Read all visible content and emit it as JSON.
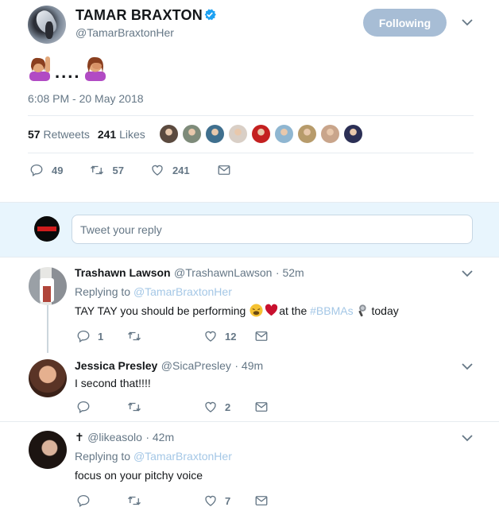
{
  "tweet": {
    "display_name": "TAMAR BRAXTON",
    "handle": "@TamarBraxtonHer",
    "follow_label": "Following",
    "text_dots": "....",
    "timestamp": "6:08 PM - 20 May 2018",
    "stats": {
      "retweets_count": "57",
      "retweets_label": "Retweets",
      "likes_count": "241",
      "likes_label": "Likes"
    },
    "liker_colors": [
      "#5b4a3f",
      "#7e8b7a",
      "#3f6f8e",
      "#d9cfc6",
      "#c42020",
      "#8fb6d1",
      "#b79b6b",
      "#c9a58b",
      "#2b2f55"
    ],
    "actions": {
      "replies": "49",
      "retweets": "57",
      "likes": "241"
    }
  },
  "composer": {
    "placeholder": "Tweet your reply"
  },
  "replies": [
    {
      "name": "Trashawn Lawson",
      "handle": "@TrashawnLawson",
      "time": "· 52m",
      "replying_prefix": "Replying to",
      "replying_to": "@TamarBraxtonHer",
      "text_a": "TAY TAY you should be performing",
      "text_b": "at the",
      "hashtag": "#BBMAs",
      "text_c": "today",
      "replies": "1",
      "retweets": "",
      "likes": "12"
    },
    {
      "name": "Jessica Presley",
      "handle": "@SicaPresley",
      "time": "· 49m",
      "text": "I second that!!!!",
      "replies": "",
      "retweets": "",
      "likes": "2"
    },
    {
      "name": "✝",
      "handle": "@likeasolo",
      "time": "· 42m",
      "replying_prefix": "Replying to",
      "replying_to": "@TamarBraxtonHer",
      "text": "focus on your pitchy voice",
      "replies": "",
      "retweets": "",
      "likes": "7"
    }
  ],
  "colors": {
    "verified": "#1da1f2",
    "follow_button_bg": "#a7bdd5",
    "composer_bg": "#e8f5fd",
    "muted_text": "#657786",
    "link": "#a4c7e6"
  },
  "icons": {
    "reply": "reply-icon",
    "retweet": "retweet-icon",
    "like": "heart-icon",
    "dm": "envelope-icon",
    "more": "chevron-down-icon",
    "verified": "verified-badge-icon"
  }
}
